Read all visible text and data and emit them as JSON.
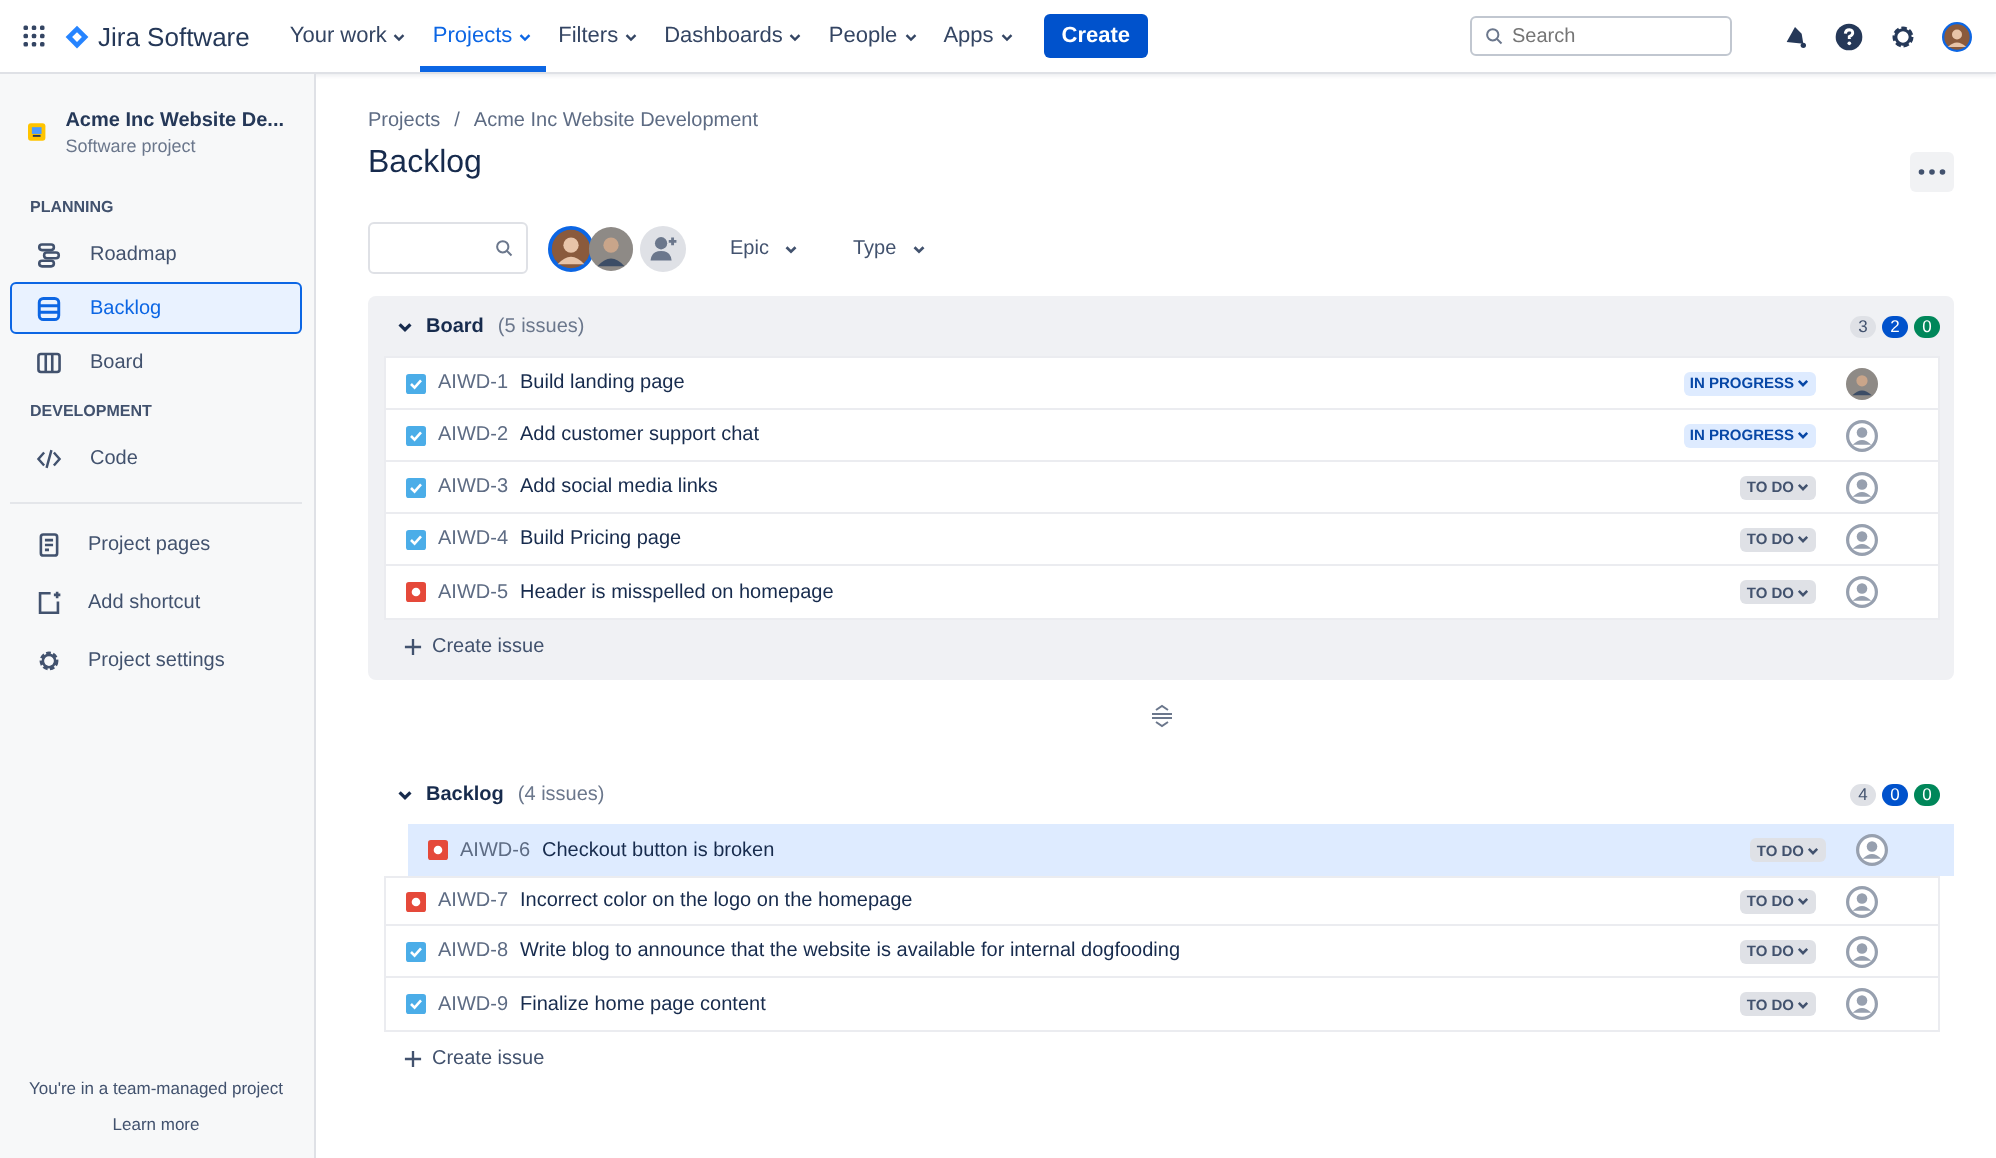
{
  "top_nav": {
    "product": "Jira Software",
    "items": [
      {
        "label": "Your work",
        "selected": false
      },
      {
        "label": "Projects",
        "selected": true
      },
      {
        "label": "Filters",
        "selected": false
      },
      {
        "label": "Dashboards",
        "selected": false
      },
      {
        "label": "People",
        "selected": false
      },
      {
        "label": "Apps",
        "selected": false
      }
    ],
    "create_button": "Create",
    "search": {
      "placeholder": "Search"
    }
  },
  "sidebar": {
    "project_name": "Acme Inc Website De...",
    "project_type": "Software project",
    "sections": [
      {
        "heading": "PLANNING",
        "items": [
          {
            "kind": "roadmap",
            "label": "Roadmap",
            "selected": false
          },
          {
            "kind": "backlog",
            "label": "Backlog",
            "selected": true
          },
          {
            "kind": "board",
            "label": "Board",
            "selected": false
          }
        ]
      },
      {
        "heading": "DEVELOPMENT",
        "items": [
          {
            "kind": "code",
            "label": "Code",
            "selected": false
          }
        ]
      }
    ],
    "links": [
      {
        "kind": "pages",
        "label": "Project pages"
      },
      {
        "kind": "shortcut",
        "label": "Add shortcut"
      },
      {
        "kind": "settings",
        "label": "Project settings"
      }
    ],
    "footer": "You're in a team-managed project",
    "learn_more": "Learn more"
  },
  "breadcrumbs": {
    "separator": "/",
    "items": [
      "Projects",
      "Acme Inc Website Development"
    ]
  },
  "page_title": "Backlog",
  "filters": [
    "Epic",
    "Type"
  ],
  "sprints": [
    {
      "name": "Board",
      "count": "(5 issues)",
      "shaded": true,
      "counts": [
        "3",
        "2",
        "0"
      ],
      "issues": [
        {
          "kind": "story",
          "key": "AIWD-1",
          "summary": "Build landing page",
          "status": {
            "kind": "in_progress",
            "label": "IN PROGRESS"
          },
          "assigned": true
        },
        {
          "kind": "story",
          "key": "AIWD-2",
          "summary": "Add customer support chat",
          "status": {
            "kind": "in_progress",
            "label": "IN PROGRESS"
          },
          "assigned": false
        },
        {
          "kind": "story",
          "key": "AIWD-3",
          "summary": "Add social media links",
          "status": {
            "kind": "todo",
            "label": "TO DO"
          },
          "assigned": false
        },
        {
          "kind": "story",
          "key": "AIWD-4",
          "summary": "Build Pricing page",
          "status": {
            "kind": "todo",
            "label": "TO DO"
          },
          "assigned": false
        },
        {
          "kind": "bug",
          "key": "AIWD-5",
          "summary": "Header is misspelled on homepage",
          "status": {
            "kind": "todo",
            "label": "TO DO"
          },
          "assigned": false
        }
      ],
      "create_issue": "Create issue"
    },
    {
      "name": "Backlog",
      "count": "(4 issues)",
      "shaded": false,
      "counts": [
        "4",
        "0",
        "0"
      ],
      "dragged": {
        "kind": "bug",
        "key": "AIWD-6",
        "summary": "Checkout button is broken",
        "status": {
          "kind": "todo",
          "label": "TO DO"
        },
        "assigned": false
      },
      "issues": [
        {
          "kind": "bug",
          "key": "AIWD-7",
          "summary": "Incorrect color on the logo on the homepage",
          "status": {
            "kind": "todo",
            "label": "TO DO"
          },
          "assigned": false
        },
        {
          "kind": "story",
          "key": "AIWD-8",
          "summary": "Write blog to announce that the website is available for internal dogfooding",
          "status": {
            "kind": "todo",
            "label": "TO DO"
          },
          "assigned": false
        },
        {
          "kind": "story",
          "key": "AIWD-9",
          "summary": "Finalize home page content",
          "status": {
            "kind": "todo",
            "label": "TO DO"
          },
          "assigned": false
        }
      ],
      "create_issue": "Create issue"
    }
  ]
}
